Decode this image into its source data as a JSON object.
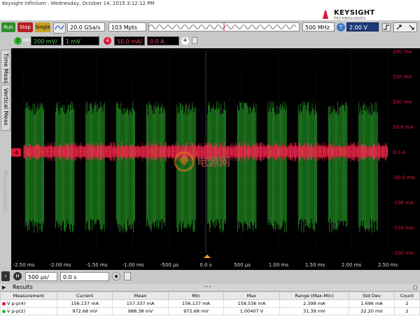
{
  "window": {
    "title": "Keysight Infiniium : Wednesday, October 14, 2015 3:12:12 PM"
  },
  "brand": {
    "name": "KEYSIGHT",
    "sub": "TECHNOLOGIES"
  },
  "toolbar": {
    "run": "Run",
    "stop": "Stop",
    "single": "Single",
    "sample_rate": "20.0 GSa/s",
    "memory": "103 Mpts",
    "bandwidth": "500 MHz",
    "trigger_channel": "T",
    "trigger_level": "2.00 V"
  },
  "channels": {
    "ch2": {
      "number": "2",
      "coupling": "1MΩ",
      "scale": "200 mV/",
      "offset": "1 mV",
      "color": "#2eb82e"
    },
    "ch4": {
      "number": "4",
      "scale": "50.0 mA/",
      "offset": "0.0 A",
      "color": "#e0143c"
    }
  },
  "sidebar": {
    "tab1": "Time Meas",
    "tab2": "Vertical Meas",
    "tab3": "Measurements"
  },
  "scope": {
    "right_axis": [
      "200 mA",
      "150 mA",
      "100 mA",
      "50.0 mA",
      "0.0 A",
      "-50.0 mA",
      "-100 mA",
      "-150 mA",
      "-200 mA"
    ],
    "x_axis": [
      "-2.50 ms",
      "-2.00 ms",
      "-1.50 ms",
      "-1.00 ms",
      "-500 µs",
      "0.0 s",
      "500 µs",
      "1.00 ms",
      "1.50 ms",
      "2.00 ms",
      "2.50 ms"
    ],
    "ch4_marker": "4",
    "watermark": "电源网"
  },
  "timebase": {
    "h": "H",
    "scale": "500 µs/",
    "position": "0.0 s"
  },
  "results": {
    "title": "Results",
    "columns": [
      "Measurement",
      "Current",
      "Mean",
      "Min",
      "Max",
      "Range (Max-Min)",
      "Std Dev",
      "Count"
    ],
    "rows": [
      {
        "name": "V p-p(4)",
        "color": "#e0143c",
        "current": "156.137 mA",
        "mean": "157.337 mA",
        "min": "156.137 mA",
        "max": "158.536 mA",
        "range": "2.398 mA",
        "std": "1.696 mA",
        "count": "2"
      },
      {
        "name": "V p-p(2)",
        "color": "#2eb82e",
        "current": "972.68 mV",
        "mean": "988.38 mV",
        "min": "972.68 mV",
        "max": "1.00407 V",
        "range": "31.39 mV",
        "std": "22.20 mV",
        "count": "2"
      }
    ]
  }
}
